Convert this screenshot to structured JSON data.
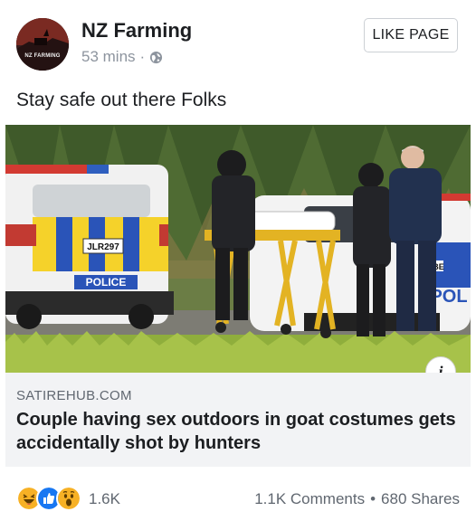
{
  "post": {
    "page_name": "NZ Farming",
    "avatar_text": "NZ FARMING",
    "time": "53 mins",
    "separator": "·",
    "privacy_icon": "globe-icon",
    "like_page_label": "LIKE PAGE",
    "text": "Stay safe out there Folks"
  },
  "link": {
    "image_texts": {
      "plate": "JLR297",
      "police_label": "POLICE",
      "pol_label": "POL",
      "plate2": "GBE"
    },
    "info_icon_label": "i",
    "domain": "SATIREHUB.COM",
    "title": "Couple having sex outdoors in goat costumes gets accidentally shot by hunters"
  },
  "reactions": {
    "icons": [
      "haha-icon",
      "like-icon",
      "wow-icon"
    ],
    "count": "1.6K",
    "comments": "1.1K Comments",
    "separator": "•",
    "shares": "680 Shares"
  },
  "colors": {
    "text": "#1c1e21",
    "meta": "#8d949e",
    "secondary": "#606770",
    "preview_bg": "#f2f3f5",
    "like_blue": "#1877f2",
    "haha_yellow": "#f7b125"
  }
}
